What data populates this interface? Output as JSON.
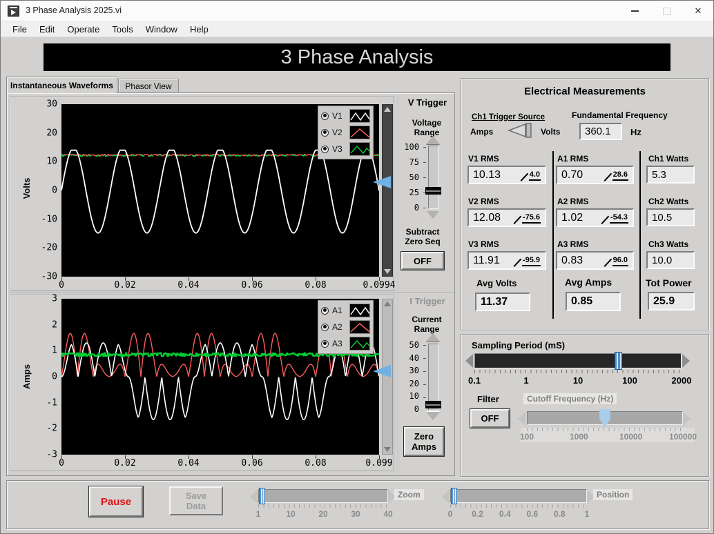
{
  "window": {
    "title": "3 Phase Analysis 2025.vi",
    "close_glyph": "✕"
  },
  "menu": {
    "items": [
      "File",
      "Edit",
      "Operate",
      "Tools",
      "Window",
      "Help"
    ]
  },
  "banner": {
    "title": "3 Phase Analysis"
  },
  "tabs": {
    "tab1": "Instantaneous Waveforms",
    "tab2": "Phasor View"
  },
  "v_trigger": {
    "label": "V Trigger",
    "range_label": "Voltage Range",
    "scale": [
      "100",
      "75",
      "50",
      "25",
      "0"
    ],
    "subtract_label": "Subtract Zero Seq",
    "off_button": "OFF"
  },
  "i_trigger": {
    "label": "I Trigger",
    "range_label": "Current Range",
    "scale": [
      "50",
      "40",
      "30",
      "20",
      "10",
      "0"
    ],
    "zero_button": "Zero Amps"
  },
  "measurements": {
    "title": "Electrical Measurements",
    "trigger_source_label": "Ch1 Trigger Source",
    "amps_option": "Amps",
    "volts_option": "Volts",
    "fundamental_label": "Fundamental Frequency",
    "fundamental_value": "360.1",
    "fundamental_unit": "Hz",
    "v1": {
      "label": "V1 RMS",
      "value": "10.13",
      "angle": "4.0"
    },
    "v2": {
      "label": "V2 RMS",
      "value": "12.08",
      "angle": "-75.6"
    },
    "v3": {
      "label": "V3 RMS",
      "value": "11.91",
      "angle": "-95.9"
    },
    "a1": {
      "label": "A1 RMS",
      "value": "0.70",
      "angle": "28.6"
    },
    "a2": {
      "label": "A2 RMS",
      "value": "1.02",
      "angle": "-54.3"
    },
    "a3": {
      "label": "A3 RMS",
      "value": "0.83",
      "angle": "96.0"
    },
    "w1": {
      "label": "Ch1 Watts",
      "value": "5.3"
    },
    "w2": {
      "label": "Ch2 Watts",
      "value": "10.5"
    },
    "w3": {
      "label": "Ch3 Watts",
      "value": "10.0"
    },
    "avg_volts": {
      "label": "Avg Volts",
      "value": "11.37"
    },
    "avg_amps": {
      "label": "Avg Amps",
      "value": "0.85"
    },
    "tot_power": {
      "label": "Tot Power",
      "value": "25.9"
    }
  },
  "sampling": {
    "label": "Sampling Period (mS)",
    "scale": [
      "0.1",
      "1",
      "10",
      "100",
      "2000"
    ],
    "value": 100
  },
  "filter": {
    "label": "Filter",
    "off_button": "OFF",
    "cutoff_label": "Cutoff Frequency (Hz)",
    "cutoff_scale": [
      "100",
      "1000",
      "10000",
      "100000"
    ]
  },
  "footer": {
    "pause": "Pause",
    "save": "Save Data",
    "zoom_label": "Zoom",
    "zoom_scale": [
      "1",
      "10",
      "20",
      "30",
      "40"
    ],
    "position_label": "Position",
    "position_scale": [
      "0",
      "0.2",
      "0.4",
      "0.6",
      "0.8",
      "1"
    ]
  },
  "colors": {
    "accent_blue": "#6fb1e4",
    "trace_white": "#ffffff",
    "trace_red": "#ff5c5c",
    "trace_green": "#00cc33",
    "pause_red": "#e01010"
  },
  "chart_data": [
    {
      "type": "line",
      "title": "Instantaneous Voltage Waveforms",
      "ylabel": "Volts",
      "ylim": [
        -30,
        30
      ],
      "yticks": [
        "30",
        "20",
        "10",
        "0",
        "-10",
        "-20",
        "-30"
      ],
      "xlim": [
        0,
        0.0994
      ],
      "xtick_labels": [
        "0",
        "0.02",
        "0.04",
        "0.06",
        "0.08",
        "0.0994"
      ],
      "grid": false,
      "legend_position": "top-right",
      "legend": [
        {
          "label": "V1",
          "color": "#ffffff",
          "sample": "1,15 8,5 15,15 22,5 29,15"
        },
        {
          "label": "V2",
          "color": "#ff5c5c",
          "sample": "1,16 14,4 28,16"
        },
        {
          "label": "V3",
          "color": "#00cc33",
          "sample": "1,15 10,5 19,15 24,8 28,12"
        }
      ],
      "trigger_level_volts": 1.5,
      "series": [
        {
          "name": "V2",
          "color": "#ff5c5c",
          "kind": "flat",
          "offset": 12.3,
          "noise": 0.25,
          "width": 1.4
        },
        {
          "name": "V3",
          "color": "#00cc33",
          "kind": "flat",
          "offset": 12.1,
          "noise": 0.25,
          "width": 1.4,
          "dash": "8 8"
        },
        {
          "name": "V1",
          "color": "#ffffff",
          "kind": "sine",
          "amplitude": 14.8,
          "clip_pos": 14.0,
          "freq_hz": 65.4,
          "offset": 0,
          "width": 1.8
        }
      ]
    },
    {
      "type": "line",
      "title": "Instantaneous Current Waveforms",
      "ylabel": "Amps",
      "ylim": [
        -3,
        3
      ],
      "yticks": [
        "3",
        "2",
        "1",
        "0",
        "-1",
        "-2",
        "-3"
      ],
      "xlim": [
        0,
        0.099
      ],
      "xtick_labels": [
        "0",
        "0.02",
        "0.04",
        "0.06",
        "0.08",
        "0.099"
      ],
      "grid": false,
      "legend_position": "top-right",
      "legend": [
        {
          "label": "A1",
          "color": "#ffffff",
          "sample": "1,15 8,5 15,15 22,5 29,15"
        },
        {
          "label": "A2",
          "color": "#ff5c5c",
          "sample": "1,16 14,4 28,16"
        },
        {
          "label": "A3",
          "color": "#00cc33",
          "sample": "1,15 10,5 19,15 24,8 28,12"
        }
      ],
      "trigger_level_amps": 0.3,
      "series": [
        {
          "name": "A2",
          "color": "#ff5c5c",
          "kind": "rect_mod",
          "carrier_hz": 101,
          "mod_hz": 50.5,
          "base": 1.0,
          "depth": 0.9,
          "floor": -0.05,
          "width": 1.4
        },
        {
          "name": "A1",
          "color": "#ffffff",
          "kind": "burst",
          "carrier_hz": 96,
          "mod_hz": 24,
          "amp_pos": 1.3,
          "amp_neg": 1.65,
          "width": 1.6
        },
        {
          "name": "A3",
          "color": "#00cc33",
          "kind": "flat",
          "offset": 0.85,
          "noise": 0.06,
          "width": 2.4
        }
      ]
    }
  ]
}
